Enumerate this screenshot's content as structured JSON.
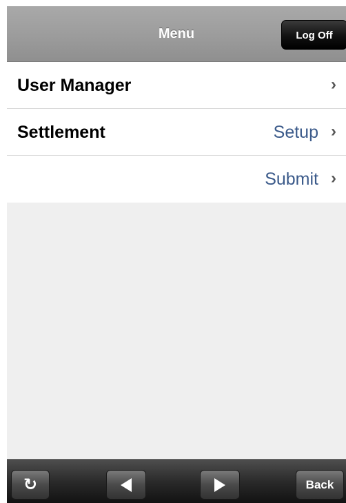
{
  "navbar": {
    "title": "Menu",
    "logoff_label": "Log Off"
  },
  "menu": {
    "rows": [
      {
        "label": "User Manager",
        "value": ""
      },
      {
        "label": "Settlement",
        "value": "Setup"
      },
      {
        "label": "",
        "value": "Submit"
      }
    ]
  },
  "toolbar": {
    "refresh_icon": "refresh-icon",
    "back_arrow_icon": "back-arrow-icon",
    "forward_arrow_icon": "forward-arrow-icon",
    "back_label": "Back"
  },
  "colors": {
    "link": "#3b5a8a",
    "navbar": "#9d9d9d",
    "toolbar": "#2a2a2a",
    "background": "#efefef"
  }
}
